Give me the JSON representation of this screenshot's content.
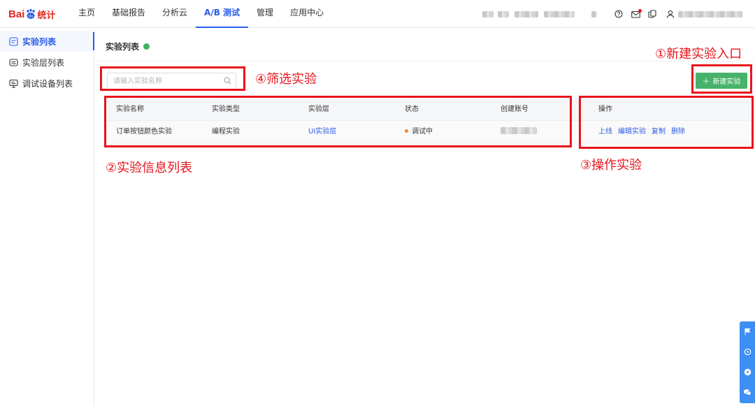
{
  "brand": {
    "bai": "Bai",
    "du": "du",
    "tongji": "统计",
    "color": "#e1261c"
  },
  "nav": {
    "items": [
      {
        "label": "主页",
        "active": false
      },
      {
        "label": "基础报告",
        "active": false
      },
      {
        "label": "分析云",
        "active": false
      },
      {
        "label": "A/B 测试",
        "active": true
      },
      {
        "label": "管理",
        "active": false
      },
      {
        "label": "应用中心",
        "active": false
      }
    ],
    "right_icons": [
      "help-icon",
      "mail-icon",
      "copy-icon",
      "user-icon"
    ]
  },
  "sidebar": {
    "items": [
      {
        "label": "实验列表",
        "icon": "experiment-list-icon",
        "active": true
      },
      {
        "label": "实验层列表",
        "icon": "layer-list-icon",
        "active": false
      },
      {
        "label": "调试设备列表",
        "icon": "device-list-icon",
        "active": false
      }
    ]
  },
  "main": {
    "title": "实验列表",
    "search": {
      "placeholder": "请输入实验名称",
      "value": ""
    },
    "new_button": {
      "label": "新建实验",
      "icon": "plus-icon"
    },
    "table": {
      "columns": [
        "实验名称",
        "实验类型",
        "实验层",
        "状态",
        "创建账号",
        "操作"
      ],
      "rows": [
        {
          "name": "订单按钮颜色实验",
          "type": "编程实验",
          "layer": "UI实验层",
          "status": "调试中",
          "account": "",
          "actions": [
            "上线",
            "编辑实验",
            "复制",
            "删除"
          ]
        }
      ]
    }
  },
  "annotations": {
    "new_entry": "①新建实验入口",
    "info_list": "②实验信息列表",
    "operations": "③操作实验",
    "filter": "④筛选实验"
  },
  "colors": {
    "accent": "#2a5ce8",
    "primary_button": "#46b26a",
    "status_debug": "#f08a24",
    "annotation_red": "#e8141c",
    "float_bar": "#3d8ef5"
  },
  "float_toolbar": {
    "icons": [
      "flag-icon",
      "feedback-icon",
      "compass-icon",
      "chat-icon"
    ]
  }
}
